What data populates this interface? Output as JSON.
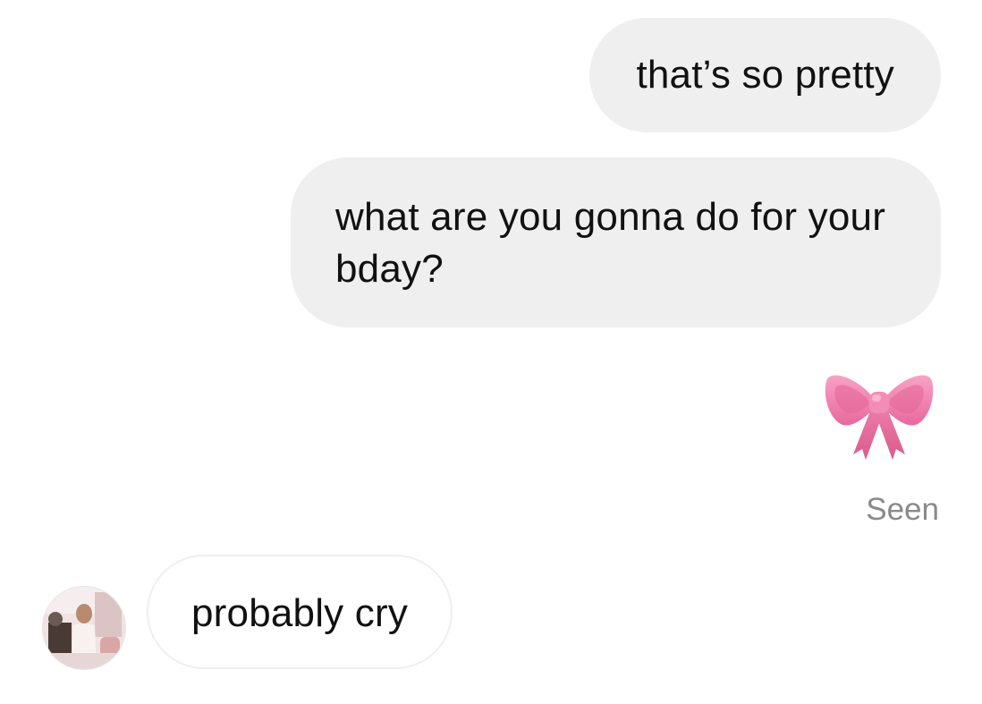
{
  "messages": [
    {
      "direction": "outgoing",
      "text": "that’s so pretty"
    },
    {
      "direction": "outgoing",
      "text": "what are you gonna do for your bday?"
    },
    {
      "direction": "outgoing",
      "emoji": "ribbon-icon"
    },
    {
      "direction": "incoming",
      "text": "probably cry"
    }
  ],
  "status": {
    "seen_label": "Seen"
  },
  "colors": {
    "sent_bubble": "#efefef",
    "received_bubble_border": "#efefef",
    "seen_text": "#8a8a8a",
    "ribbon": "#f07ca9"
  }
}
